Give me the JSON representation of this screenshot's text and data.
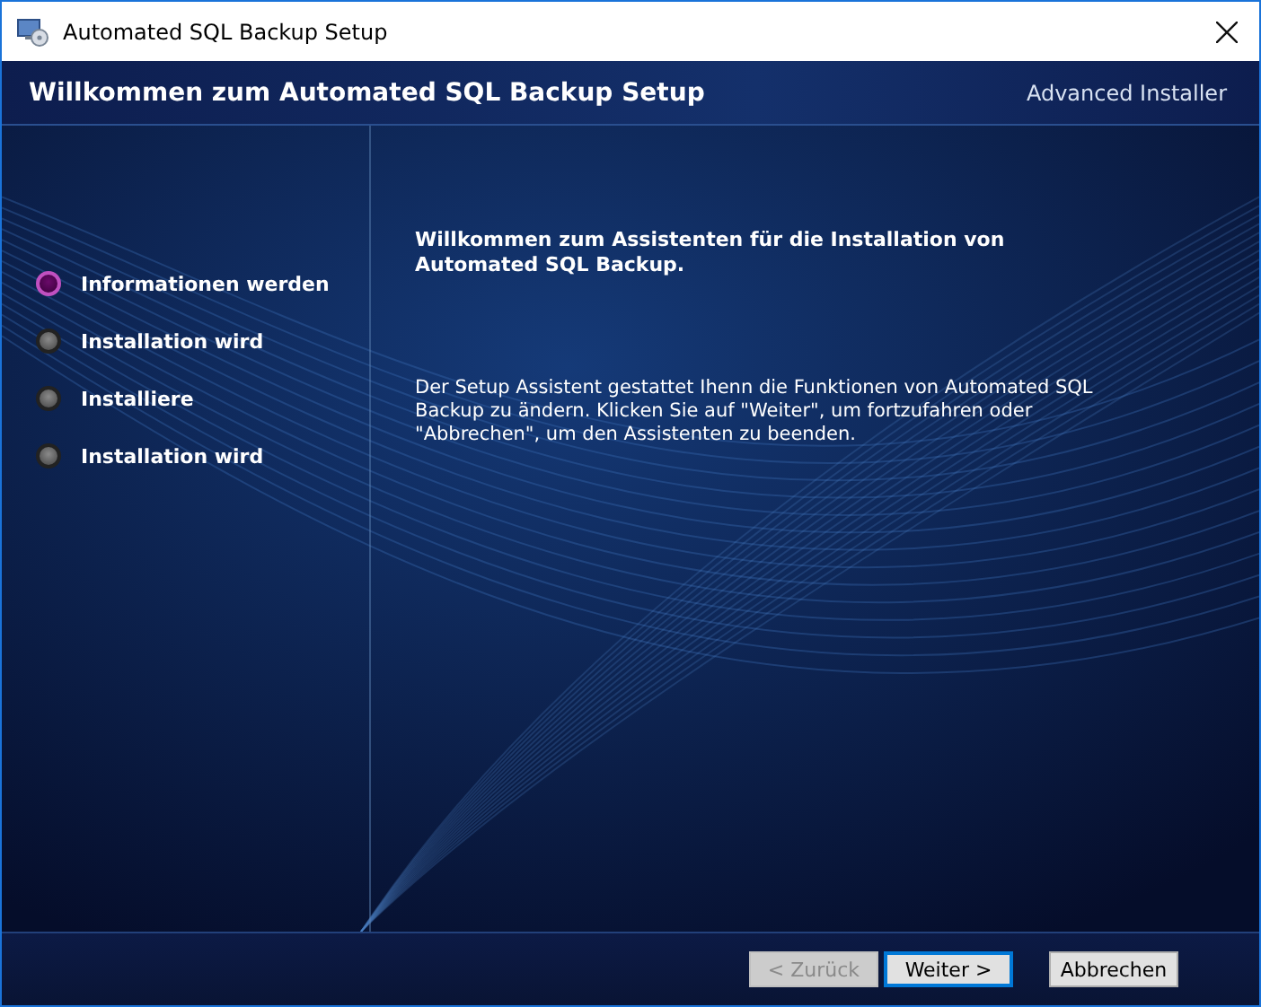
{
  "window": {
    "title": "Automated SQL Backup Setup"
  },
  "header": {
    "title": "Willkommen zum Automated SQL Backup Setup",
    "brand": "Advanced Installer"
  },
  "steps": [
    {
      "label": "Informationen werden",
      "selected": true
    },
    {
      "label": "Installation wird",
      "selected": false
    },
    {
      "label": "Installiere",
      "selected": false
    },
    {
      "label": "Installation wird",
      "selected": false
    }
  ],
  "content": {
    "heading": "Willkommen zum Assistenten für die Installation von Automated SQL Backup.",
    "text": "Der Setup Assistent gestattet Ihenn die Funktionen von Automated SQL Backup zu ändern. Klicken Sie auf \"Weiter\", um fortzufahren oder \"Abbrechen\", um den Assistenten zu beenden."
  },
  "buttons": [
    {
      "label": "< Zurück",
      "disabled": true,
      "default": false
    },
    {
      "label": "Weiter >",
      "disabled": false,
      "default": true
    },
    {
      "label": "Abbrechen",
      "disabled": false,
      "default": false
    }
  ]
}
